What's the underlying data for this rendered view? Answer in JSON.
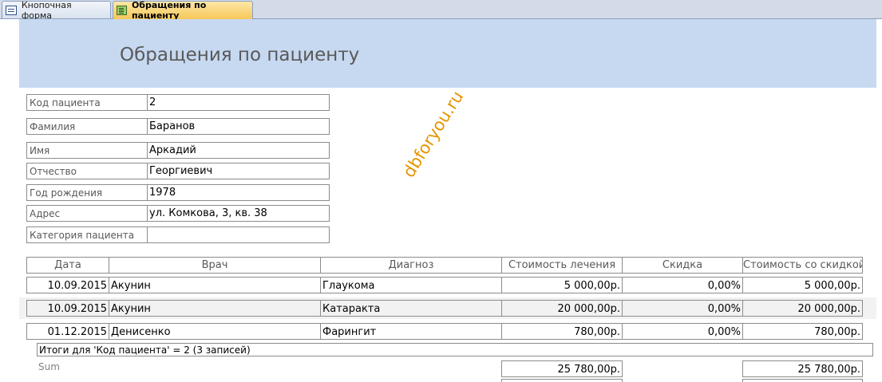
{
  "tabs": [
    {
      "label": "Кнопочная форма",
      "icon": "form-icon",
      "active": false
    },
    {
      "label": "Обращения по пациенту",
      "icon": "report-icon",
      "active": true
    }
  ],
  "report": {
    "title": "Обращения по пациенту",
    "fields": [
      {
        "label": "Код пациента",
        "value": "2"
      },
      {
        "label": "Фамилия",
        "value": "Баранов"
      },
      {
        "label": "Имя",
        "value": "Аркадий"
      },
      {
        "label": "Отчество",
        "value": "Георгиевич"
      },
      {
        "label": "Год рождения",
        "value": "1978"
      },
      {
        "label": "Адрес",
        "value": "ул. Комкова, 3, кв. 38"
      },
      {
        "label": "Категория пациента",
        "value": ""
      }
    ],
    "watermark": "dbforyou.ru",
    "columns": [
      "Дата",
      "Врач",
      "Диагноз",
      "Стоимость лечения",
      "Скидка",
      "Стоимость со скидкой"
    ],
    "rows": [
      [
        "10.09.2015",
        "Акунин",
        "Глаукома",
        "5 000,00р.",
        "0,00%",
        "5 000,00р."
      ],
      [
        "10.09.2015",
        "Акунин",
        "Катаракта",
        "20 000,00р.",
        "0,00%",
        "20 000,00р."
      ],
      [
        "01.12.2015",
        "Денисенко",
        "Фарингит",
        "780,00р.",
        "0,00%",
        "780,00р."
      ]
    ],
    "group_footer": "Итоги для 'Код пациента' =  2 (3 записей)",
    "sum_label": "Sum",
    "sum_cost": "25 780,00р.",
    "sum_discounted": "25 780,00р."
  },
  "colors": {
    "header_band": "#c6d9f1",
    "active_tab": "#f6c758",
    "alt_row": "#f2f2f2",
    "watermark": "#e69500"
  }
}
